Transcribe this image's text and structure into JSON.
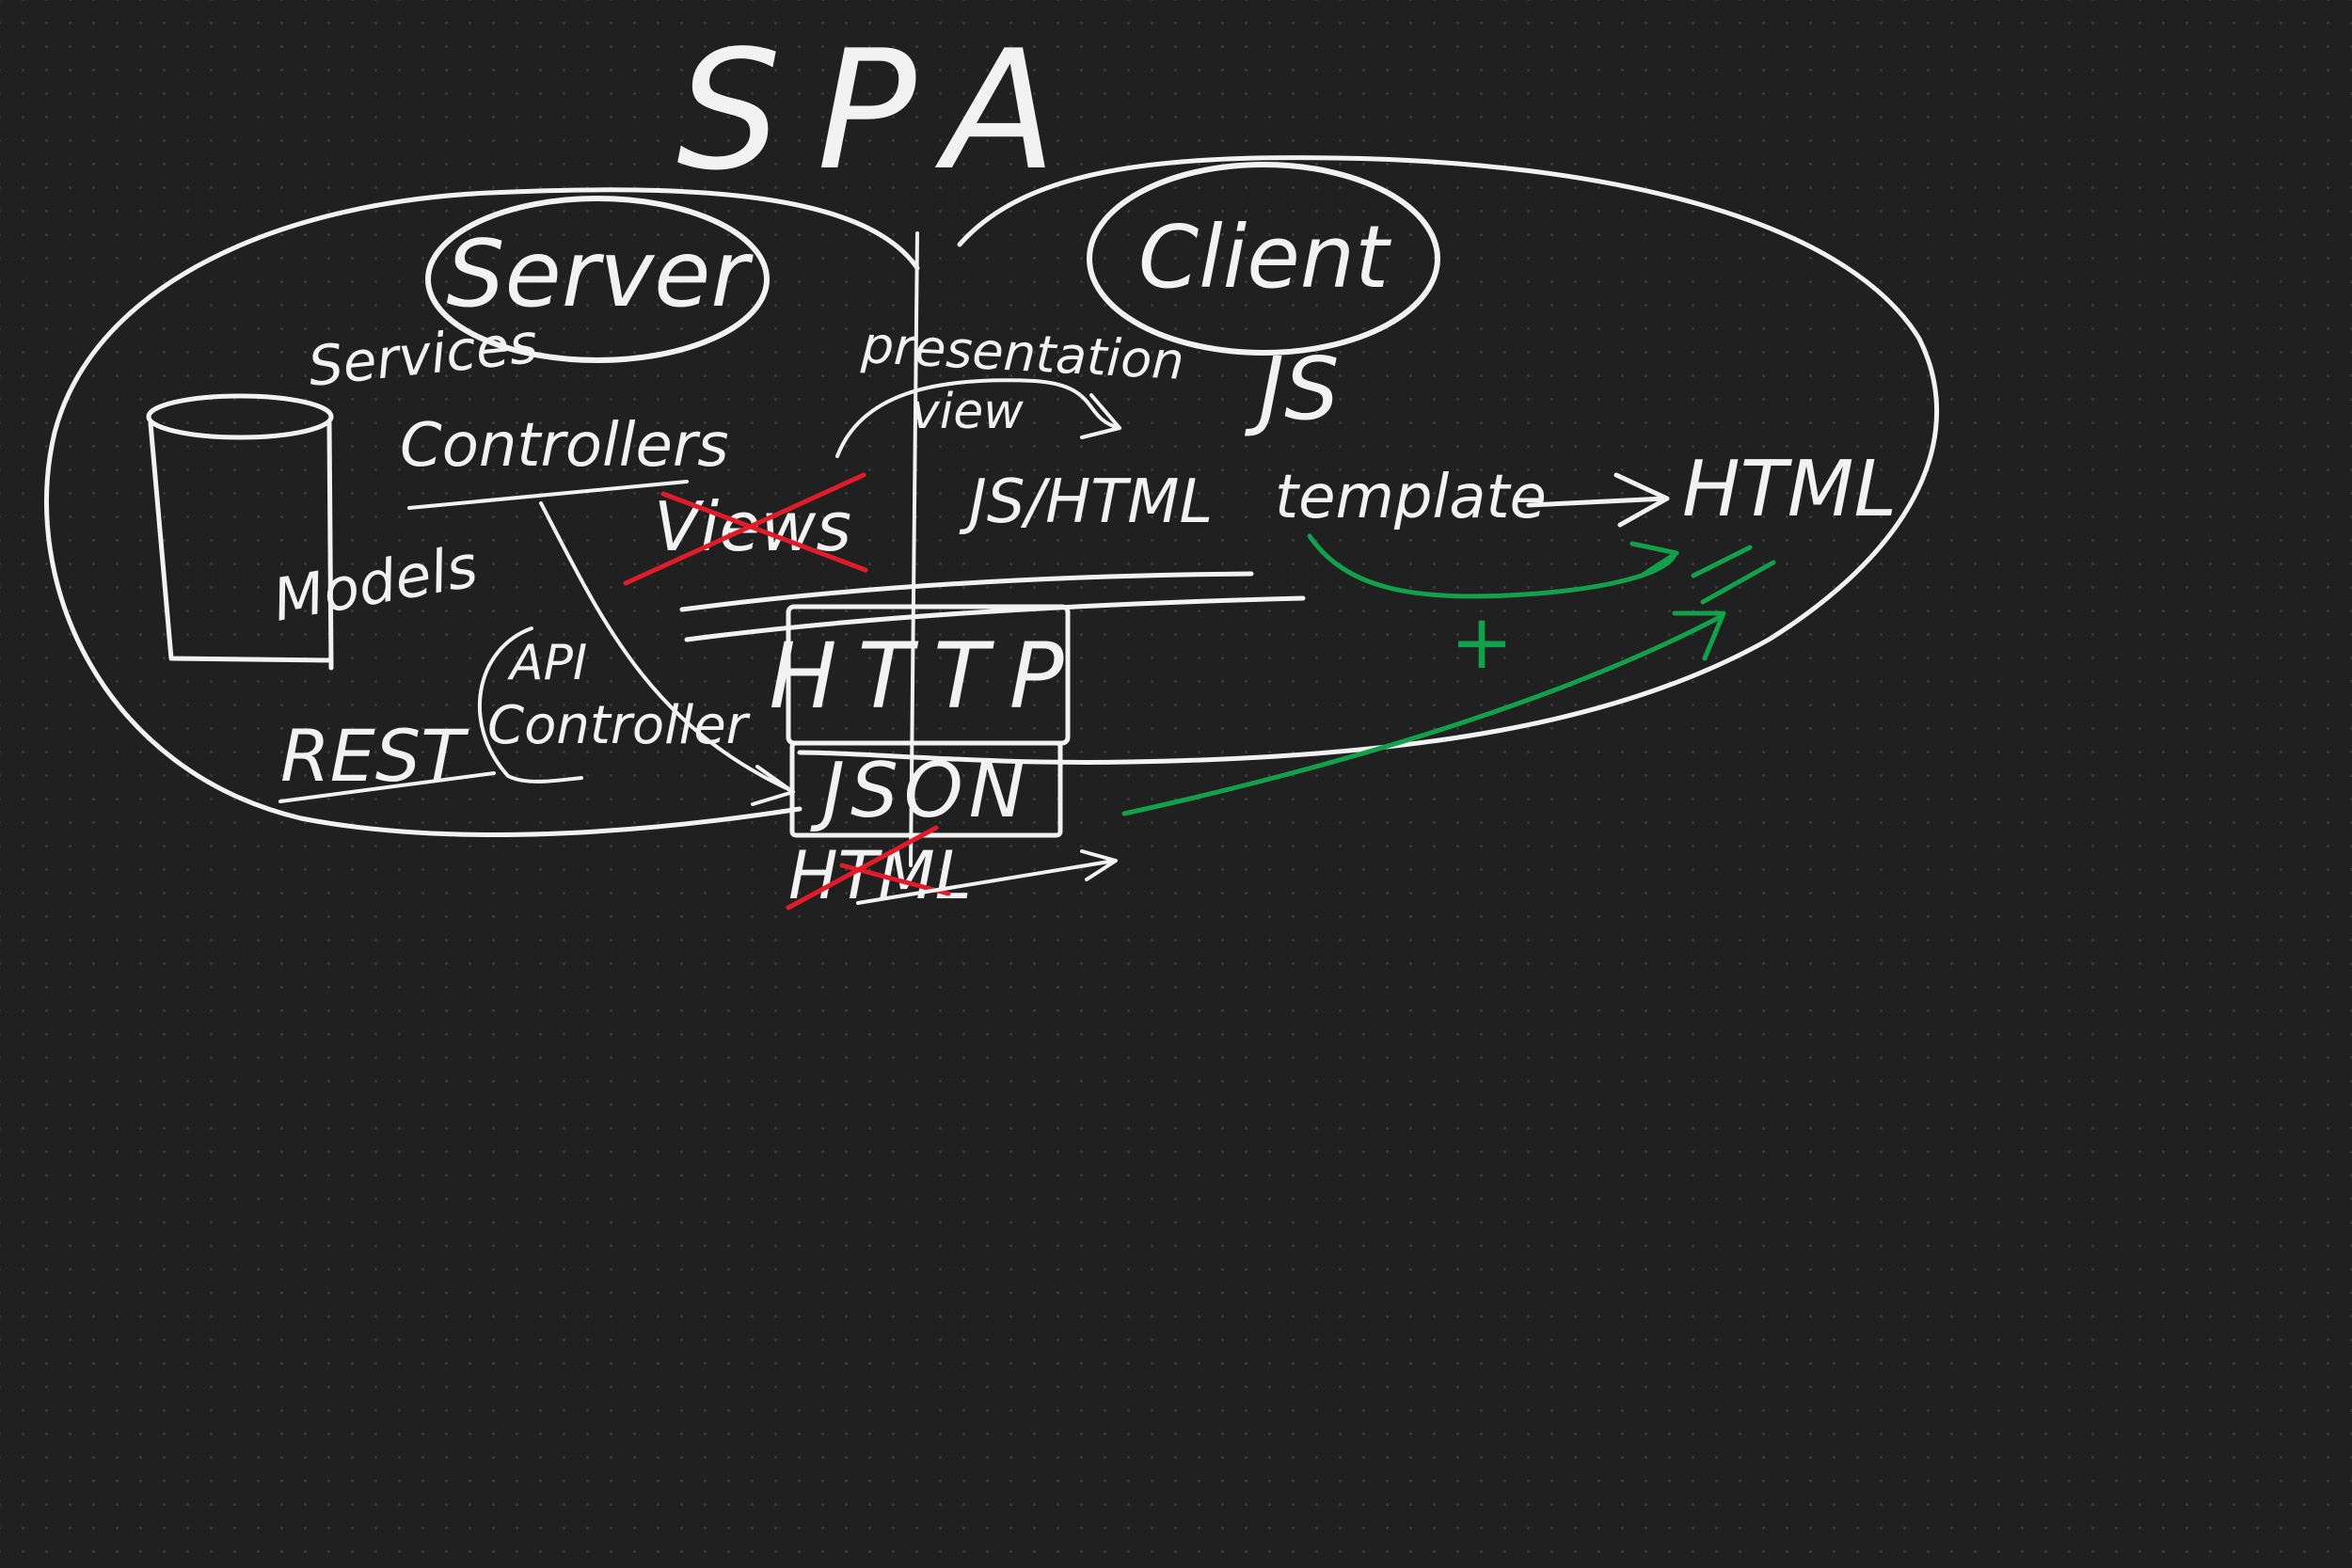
{
  "colors": {
    "background": "#202020",
    "ink": "#f2f2f2",
    "strike": "#e01b2a",
    "green": "#12a14a"
  },
  "labels": {
    "title": "SPA",
    "server": "Server",
    "client": "Client",
    "services": "Services",
    "controllers": "Controllers",
    "views": "Views",
    "models": "Models",
    "rest": "REST",
    "api": "API",
    "controller": "Controller",
    "presentation": "presentation",
    "view": "view",
    "js": "JS",
    "js_html": "JS/HTML",
    "template": "template",
    "html_out": "HTML",
    "http": "HTTP",
    "json": "JSON",
    "html_crossed": "HTML",
    "plus": "+",
    "equals": "="
  }
}
